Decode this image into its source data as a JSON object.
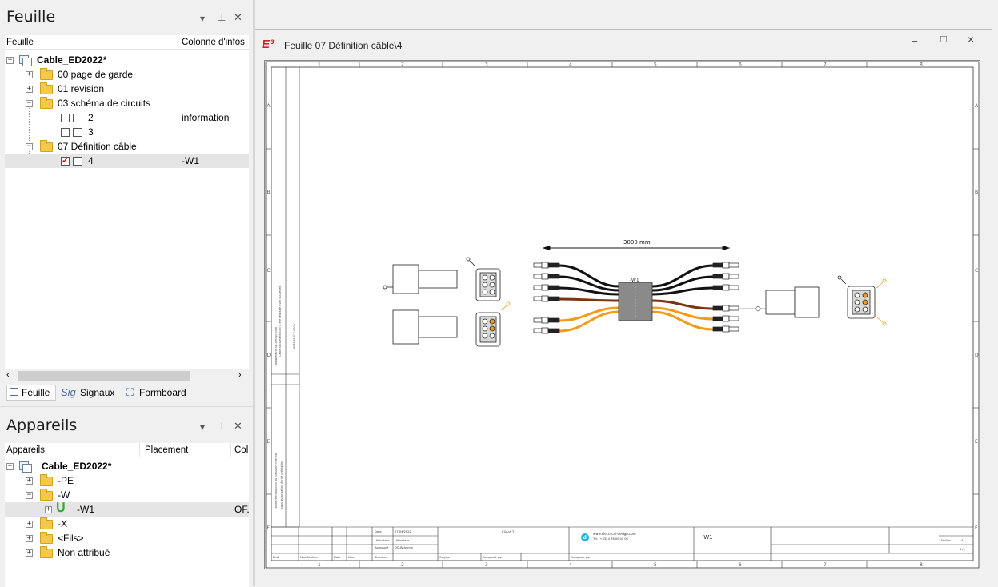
{
  "sheet_panel": {
    "title": "Feuille",
    "col_headers": [
      "Feuille",
      "Colonne d'infos"
    ],
    "tree": [
      {
        "label": "Cable_ED2022*",
        "info": ""
      },
      {
        "label": "00 page de garde",
        "info": ""
      },
      {
        "label": "01 revision",
        "info": ""
      },
      {
        "label": "03 schéma de circuits",
        "info": ""
      },
      {
        "label": "2",
        "info": "information"
      },
      {
        "label": "3",
        "info": ""
      },
      {
        "label": "07 Définition câble",
        "info": ""
      },
      {
        "label": "4",
        "info": "-W1"
      }
    ],
    "tabs": [
      "Feuille",
      "Signaux",
      "Formboard"
    ],
    "tab_sig_prefix": "Sig"
  },
  "device_panel": {
    "title": "Appareils",
    "col_headers": [
      "Appareils",
      "Placement",
      "Col"
    ],
    "tree": [
      {
        "label": "Cable_ED2022*",
        "placement": "",
        "col": ""
      },
      {
        "label": "-PE",
        "placement": "",
        "col": ""
      },
      {
        "label": "-W",
        "placement": "",
        "col": ""
      },
      {
        "label": "-W1",
        "placement": "",
        "col": "OF."
      },
      {
        "label": "-X",
        "placement": "",
        "col": ""
      },
      {
        "label": "<Fils>",
        "placement": "",
        "col": ""
      },
      {
        "label": "Non attribué",
        "placement": "",
        "col": ""
      }
    ]
  },
  "doc_window": {
    "title": "Feuille 07 Définition câble\\4",
    "logo": "E³",
    "controls": [
      "–",
      "□",
      "×"
    ]
  },
  "drawing": {
    "length_label": "3000 mm",
    "cable_label": "-W1",
    "title_block": {
      "client": "Client 1",
      "company": "www.electrical-design.com",
      "phone": "Tel: (+33) 4 78 00 00 00",
      "sheet_ref": "-W1",
      "date_label": "Date",
      "date": "27/04/2022",
      "user_label": "Utilisateur",
      "user": "Utilisateur 1",
      "approved_label": "Approuvé",
      "approved": "DO-W Admin",
      "standard_label": "Standard",
      "bottom": [
        "Etat",
        "Modification",
        "Date",
        "Nom",
        "Origine",
        "Remplacé par",
        "Remplace par"
      ],
      "sheet_label": "Feuille",
      "sheet_num": "4",
      "scale": "1 /1"
    },
    "col_numbers": [
      "1",
      "2",
      "3",
      "4",
      "5",
      "6",
      "7",
      "8"
    ],
    "row_letters": [
      "A",
      "B",
      "C",
      "D",
      "E",
      "F"
    ],
    "wire_colors": {
      "black": "#111111",
      "brown": "#7a3410",
      "orange": "#f29a1a"
    }
  }
}
